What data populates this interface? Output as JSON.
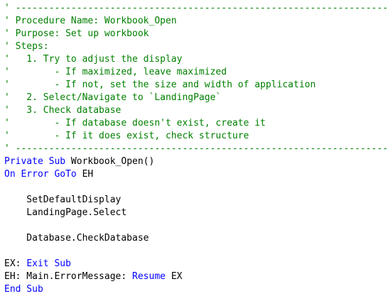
{
  "colors": {
    "background": "#ffffff",
    "comment": "#008000",
    "keyword": "#0000ff",
    "text": "#000000"
  },
  "code_lines": [
    [
      {
        "t": "comment",
        "v": "' --------------------------------------------------------------------"
      }
    ],
    [
      {
        "t": "comment",
        "v": "' Procedure Name: Workbook_Open"
      }
    ],
    [
      {
        "t": "comment",
        "v": "' Purpose: Set up workbook"
      }
    ],
    [
      {
        "t": "comment",
        "v": "' Steps:"
      }
    ],
    [
      {
        "t": "comment",
        "v": "'   1. Try to adjust the display"
      }
    ],
    [
      {
        "t": "comment",
        "v": "'        - If maximized, leave maximized"
      }
    ],
    [
      {
        "t": "comment",
        "v": "'        - If not, set the size and width of application"
      }
    ],
    [
      {
        "t": "comment",
        "v": "'   2. Select/Navigate to `LandingPage`"
      }
    ],
    [
      {
        "t": "comment",
        "v": "'   3. Check database"
      }
    ],
    [
      {
        "t": "comment",
        "v": "'        - If database doesn't exist, create it"
      }
    ],
    [
      {
        "t": "comment",
        "v": "'        - If it does exist, check structure"
      }
    ],
    [
      {
        "t": "comment",
        "v": "' --------------------------------------------------------------------"
      }
    ],
    [
      {
        "t": "keyword",
        "v": "Private Sub "
      },
      {
        "t": "text",
        "v": "Workbook_Open()"
      }
    ],
    [
      {
        "t": "keyword",
        "v": "On Error GoTo "
      },
      {
        "t": "text",
        "v": "EH"
      }
    ],
    [],
    [
      {
        "t": "text",
        "v": "    SetDefaultDisplay"
      }
    ],
    [
      {
        "t": "text",
        "v": "    LandingPage.Select"
      }
    ],
    [],
    [
      {
        "t": "text",
        "v": "    Database.CheckDatabase"
      }
    ],
    [],
    [
      {
        "t": "text",
        "v": "EX: "
      },
      {
        "t": "keyword",
        "v": "Exit Sub"
      }
    ],
    [
      {
        "t": "text",
        "v": "EH: Main.ErrorMessage: "
      },
      {
        "t": "keyword",
        "v": "Resume "
      },
      {
        "t": "text",
        "v": "EX"
      }
    ],
    [
      {
        "t": "keyword",
        "v": "End Sub"
      }
    ]
  ]
}
